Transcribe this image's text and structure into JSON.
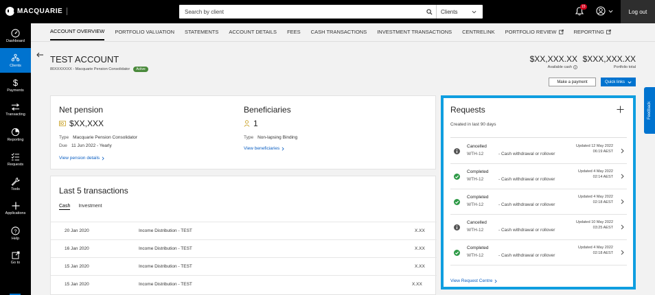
{
  "brand": {
    "name": "MACQUARIE"
  },
  "search": {
    "placeholder": "Search by client",
    "scope": "Clients"
  },
  "notifications": {
    "count": "15"
  },
  "header": {
    "logout_label": "Log out"
  },
  "nav": {
    "items": [
      {
        "label": "Dashboard",
        "icon": "dashboard-icon"
      },
      {
        "label": "Clients",
        "icon": "clients-icon",
        "active": true
      },
      {
        "label": "Payments",
        "icon": "dollar-icon"
      },
      {
        "label": "Transacting",
        "icon": "transfer-icon"
      },
      {
        "label": "Reporting",
        "icon": "pie-chart-icon"
      },
      {
        "label": "Requests",
        "icon": "checklist-icon"
      },
      {
        "label": "Tools",
        "icon": "wrench-icon"
      },
      {
        "label": "Applications",
        "icon": "plus-icon"
      },
      {
        "label": "Help",
        "icon": "question-icon"
      },
      {
        "label": "Go to",
        "icon": "external-link-icon"
      }
    ]
  },
  "tabs": [
    {
      "label": "ACCOUNT OVERVIEW",
      "active": true
    },
    {
      "label": "PORTFOLIO VALUATION"
    },
    {
      "label": "STATEMENTS"
    },
    {
      "label": "ACCOUNT DETAILS"
    },
    {
      "label": "FEES"
    },
    {
      "label": "CASH TRANSACTIONS"
    },
    {
      "label": "INVESTMENT TRANSACTIONS"
    },
    {
      "label": "CENTRELINK"
    },
    {
      "label": "PORTFOLIO REVIEW",
      "external": true
    },
    {
      "label": "REPORTING",
      "external": true
    }
  ],
  "account": {
    "title": "TEST ACCOUNT",
    "subtitle": "80XXXXXXX - Macquarie Pension Consolidator",
    "status": "Active",
    "available_cash": "$XX,XXX.XX",
    "available_cash_label": "Available cash",
    "portfolio_total": "$XXX,XXX.XX",
    "portfolio_total_label": "Portfolio total"
  },
  "actions": {
    "make_payment": "Make a payment",
    "quick_links": "Quick links"
  },
  "feedback_label": "Feedback",
  "pension": {
    "title": "Net pension",
    "value": "$XX,XXX",
    "type_label": "Type",
    "type_value": "Macquarie Pension Consolidator",
    "due_label": "Due",
    "due_value": "11 Jun 2022 - Yearly",
    "link": "View pension details"
  },
  "beneficiaries": {
    "title": "Beneficiaries",
    "count": "1",
    "type_label": "Type",
    "type_value": "Non-lapsing Binding",
    "link": "View beneficiaries"
  },
  "transactions": {
    "title": "Last 5 transactions",
    "tabs": [
      "Cash",
      "Investment"
    ],
    "rows": [
      {
        "date": "20 Jan 2020",
        "description": "Income Distribution - TEST",
        "amount": "X.XX"
      },
      {
        "date": "16 Jan 2020",
        "description": "Income Distribution - TEST",
        "amount": "X.XX"
      },
      {
        "date": "15 Jan 2020",
        "description": "Income Distribution - TEST",
        "amount": "X.XX"
      },
      {
        "date": "15 Jan 2020",
        "description": "Income Distribution - TEST",
        "amount": "X.XX"
      }
    ]
  },
  "requests": {
    "title": "Requests",
    "subtitle": "Created in last 90 days",
    "items": [
      {
        "status": "Cancelled",
        "code": "WTH-12",
        "description": "- Cash withdrawal or rollover",
        "updated": "Updated 12 May 2022",
        "time": "06:19 AEST",
        "icon": "info-icon"
      },
      {
        "status": "Completed",
        "code": "WTH-12",
        "description": "- Cash withdrawal or rollover",
        "updated": "Updated 4 May 2022",
        "time": "02:14 AEST",
        "icon": "check-icon"
      },
      {
        "status": "Completed",
        "code": "WTH-12",
        "description": "- Cash withdrawal or rollover",
        "updated": "Updated 4 May 2022",
        "time": "02:18 AEST",
        "icon": "check-icon"
      },
      {
        "status": "Cancelled",
        "code": "WTH-12",
        "description": "- Cash withdrawal or rollover",
        "updated": "Updated 10 May 2022",
        "time": "03:25 AEST",
        "icon": "info-icon"
      },
      {
        "status": "Completed",
        "code": "WTH-12",
        "description": "- Cash withdrawal or rollover",
        "updated": "Updated 4 May 2022",
        "time": "02:18 AEST",
        "icon": "check-icon"
      }
    ],
    "footer_link": "View Request Centre"
  },
  "colors": {
    "accent": "#0073cf",
    "highlight": "#0f9ee0",
    "success": "#2e9a47",
    "active_badge": "#4a8a3c"
  }
}
